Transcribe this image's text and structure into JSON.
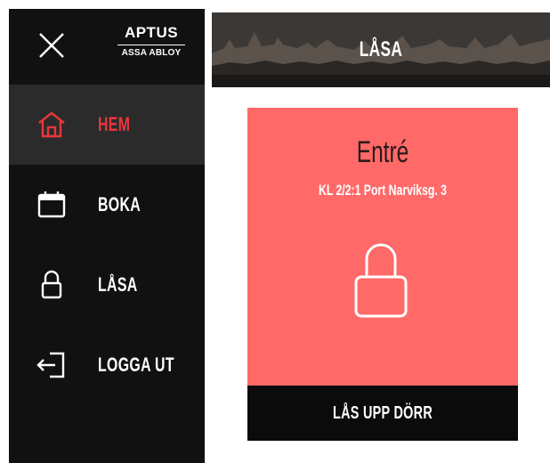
{
  "brand": {
    "name": "APTUS",
    "sub": "ASSA ABLOY"
  },
  "drawer": {
    "close_icon": "close-icon",
    "items": [
      {
        "label": "HEM",
        "icon": "home-icon",
        "active": true
      },
      {
        "label": "BOKA",
        "icon": "calendar-icon",
        "active": false
      },
      {
        "label": "LÅSA",
        "icon": "lock-icon",
        "active": false
      },
      {
        "label": "LOGGA UT",
        "icon": "logout-icon",
        "active": false
      }
    ]
  },
  "header": {
    "title": "LÅSA"
  },
  "card": {
    "title": "Entré",
    "subtitle": "KL 2/2:1 Port Narviksg. 3",
    "icon": "padlock-icon",
    "button_label": "LÅS UPP DÖRR"
  },
  "colors": {
    "drawer_bg": "#111111",
    "active_bg": "#2b2b2b",
    "accent_red": "#e8363e",
    "card_bg": "#ff6a69",
    "button_bg": "#0b0b0b"
  }
}
